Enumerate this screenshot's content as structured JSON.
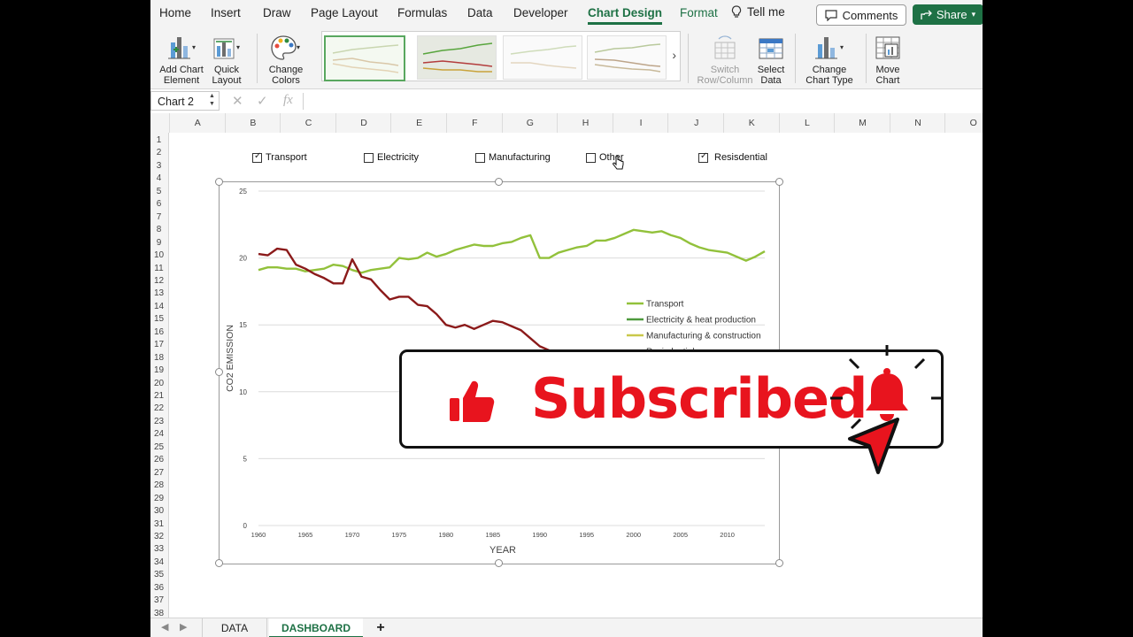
{
  "ribbon_tabs": [
    "Home",
    "Insert",
    "Draw",
    "Page Layout",
    "Formulas",
    "Data",
    "Developer",
    "Chart Design",
    "Format"
  ],
  "active_tab": "Chart Design",
  "tell_me": "Tell me",
  "comments_label": "Comments",
  "share_label": "Share",
  "ribbon": {
    "add_chart_element": [
      "Add Chart",
      "Element"
    ],
    "quick_layout": [
      "Quick",
      "Layout"
    ],
    "change_colors": [
      "Change",
      "Colors"
    ],
    "switch_row_column": [
      "Switch",
      "Row/Column"
    ],
    "select_data": [
      "Select",
      "Data"
    ],
    "change_chart_type": [
      "Change",
      "Chart Type"
    ],
    "move_chart": [
      "Move",
      "Chart"
    ]
  },
  "name_box": "Chart 2",
  "formula_icons": {
    "cancel": "✕",
    "enter": "✓",
    "fx": "fx"
  },
  "columns": [
    "A",
    "B",
    "C",
    "D",
    "E",
    "F",
    "G",
    "H",
    "I",
    "J",
    "K",
    "L",
    "M",
    "N",
    "O"
  ],
  "row_count": 38,
  "checkboxes": [
    {
      "label": "Transport",
      "checked": true
    },
    {
      "label": "Electricity",
      "checked": false
    },
    {
      "label": "Manufacturing",
      "checked": false
    },
    {
      "label": "Other",
      "checked": false
    },
    {
      "label": "Resisdential",
      "checked": true
    }
  ],
  "chart_data": {
    "type": "line",
    "xlabel": "YEAR",
    "ylabel": "CO2 EMISSION",
    "xlim": [
      1960,
      2014
    ],
    "ylim": [
      0,
      25
    ],
    "xticks": [
      1960,
      1965,
      1970,
      1975,
      1980,
      1985,
      1990,
      1995,
      2000,
      2005,
      2010
    ],
    "yticks": [
      0,
      5,
      10,
      15,
      20,
      25
    ],
    "grid": true,
    "legend_position": "right",
    "series": [
      {
        "name": "Transport",
        "color": "#92c13b",
        "x": [
          1960,
          1961,
          1962,
          1963,
          1964,
          1965,
          1966,
          1967,
          1968,
          1969,
          1970,
          1971,
          1972,
          1973,
          1974,
          1975,
          1976,
          1977,
          1978,
          1979,
          1980,
          1981,
          1982,
          1983,
          1984,
          1985,
          1986,
          1987,
          1988,
          1989,
          1990,
          1991,
          1992,
          1993,
          1994,
          1995,
          1996,
          1997,
          1998,
          1999,
          2000,
          2001,
          2002,
          2003,
          2004,
          2005,
          2006,
          2007,
          2008,
          2009,
          2010,
          2011,
          2012,
          2013,
          2014
        ],
        "values": [
          19.1,
          19.3,
          19.3,
          19.2,
          19.2,
          19.0,
          19.1,
          19.2,
          19.5,
          19.4,
          19.1,
          18.9,
          19.1,
          19.2,
          19.3,
          20.0,
          19.9,
          20.0,
          20.4,
          20.1,
          20.3,
          20.6,
          20.8,
          21.0,
          20.9,
          20.9,
          21.1,
          21.2,
          21.5,
          21.7,
          20.0,
          20.0,
          20.4,
          20.6,
          20.8,
          20.9,
          21.3,
          21.3,
          21.5,
          21.8,
          22.1,
          22.0,
          21.9,
          22.0,
          21.7,
          21.5,
          21.1,
          20.8,
          20.6,
          20.5,
          20.4,
          20.1,
          19.8,
          20.1,
          20.5
        ]
      },
      {
        "name": "Electricity & heat production",
        "color": "#4e9a3d",
        "values": []
      },
      {
        "name": "Manufacturing  & construction",
        "color": "#c9c84a",
        "values": []
      },
      {
        "name": "Resisdential",
        "color": "#8b1a1a",
        "x": [
          1960,
          1961,
          1962,
          1963,
          1964,
          1965,
          1966,
          1967,
          1968,
          1969,
          1970,
          1971,
          1972,
          1973,
          1974,
          1975,
          1976,
          1977,
          1978,
          1979,
          1980,
          1981,
          1982,
          1983,
          1984,
          1985,
          1986,
          1987,
          1988,
          1989,
          1990,
          1991
        ],
        "values": [
          20.3,
          20.2,
          20.7,
          20.6,
          19.5,
          19.2,
          18.8,
          18.5,
          18.1,
          18.1,
          19.9,
          18.6,
          18.4,
          17.6,
          16.9,
          17.1,
          17.1,
          16.5,
          16.4,
          15.8,
          15.0,
          14.8,
          15.0,
          14.7,
          15.0,
          15.3,
          15.2,
          14.9,
          14.6,
          14.0,
          13.4,
          13.1
        ]
      }
    ]
  },
  "overlay_text": "Subscribed",
  "sheet_tabs": [
    "DATA",
    "DASHBOARD"
  ],
  "active_sheet": "DASHBOARD",
  "add_sheet_label": "+"
}
